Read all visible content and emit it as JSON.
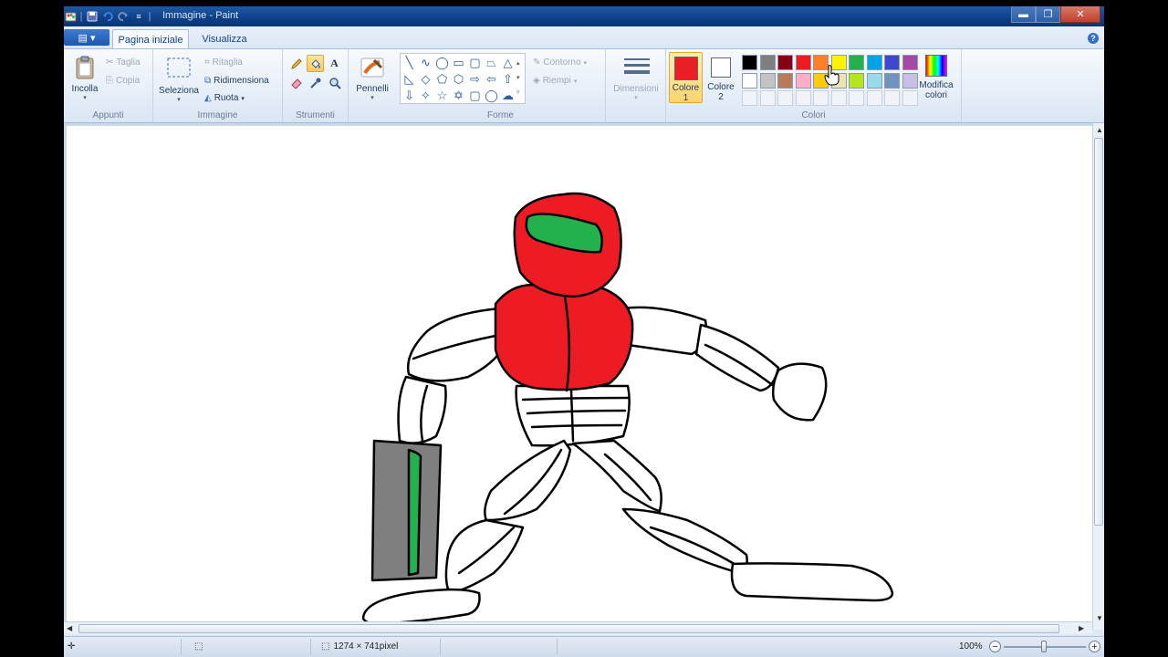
{
  "window": {
    "title": "Immagine - Paint"
  },
  "tabs": {
    "file_label": "▤ ▾",
    "home": "Pagina iniziale",
    "view": "Visualizza"
  },
  "ribbon": {
    "clipboard": {
      "label": "Appunti",
      "paste": "Incolla",
      "cut": "Taglia",
      "copy": "Copia"
    },
    "image": {
      "label": "Immagine",
      "select": "Seleziona",
      "crop": "Ritaglia",
      "resize": "Ridimensiona",
      "rotate": "Ruota"
    },
    "tools": {
      "label": "Strumenti",
      "active": "fill-icon"
    },
    "brushes": {
      "label": "Pennelli"
    },
    "shapes": {
      "label": "Forme",
      "outline": "Contorno",
      "fill": "Riempi"
    },
    "size": {
      "label": "Dimensioni"
    },
    "colors": {
      "label": "Colori",
      "color1_label": "Colore 1",
      "color2_label": "Colore 2",
      "color1": "#e82026",
      "color2": "#ffffff",
      "edit_label": "Modifica colori",
      "palette_row1": [
        "#000000",
        "#7f7f7f",
        "#880015",
        "#ed1c24",
        "#ff7f27",
        "#fff200",
        "#22b14c",
        "#00a2e8",
        "#3f48cc",
        "#a349a4"
      ],
      "palette_row2": [
        "#ffffff",
        "#c3c3c3",
        "#b97a57",
        "#ffaec9",
        "#ffc90e",
        "#efe4b0",
        "#b5e61d",
        "#99d9ea",
        "#7092be",
        "#c8bfe7"
      ]
    }
  },
  "drawing": {
    "colors": {
      "red": "#ed1c24",
      "green": "#22b14c",
      "gray": "#7f7f7f",
      "outline": "#000000"
    }
  },
  "statusbar": {
    "dimensions": "1274 × 741pixel",
    "zoom": "100%"
  }
}
